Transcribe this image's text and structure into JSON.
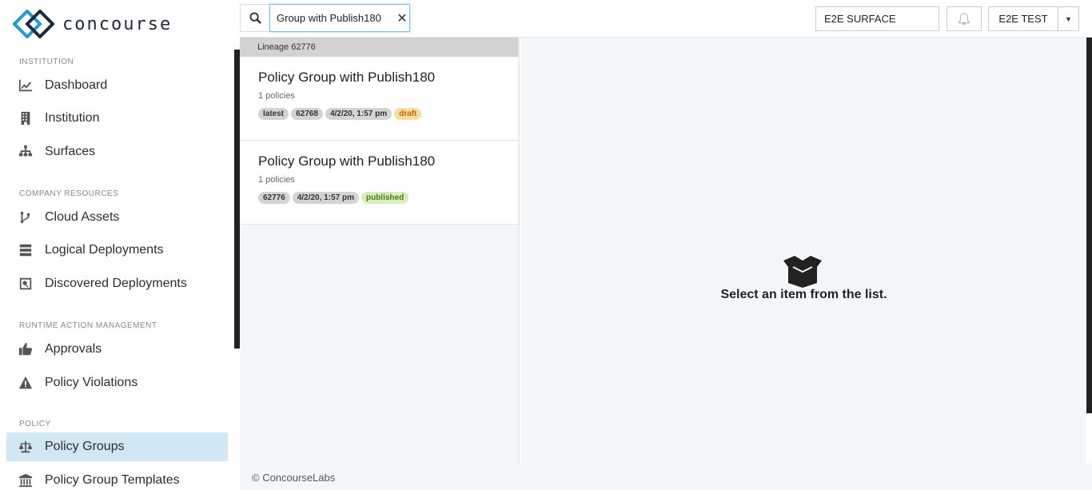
{
  "app": {
    "logo_text": "concourse"
  },
  "sidebar": {
    "sections": [
      {
        "title": "INSTITUTION"
      },
      {
        "title": "COMPANY RESOURCES"
      },
      {
        "title": "RUNTIME ACTION MANAGEMENT"
      },
      {
        "title": "POLICY"
      }
    ],
    "items": [
      {
        "label": "Dashboard",
        "icon": "chart-icon"
      },
      {
        "label": "Institution",
        "icon": "building-icon"
      },
      {
        "label": "Surfaces",
        "icon": "sitemap-icon"
      },
      {
        "label": "Cloud Assets",
        "icon": "branch-icon"
      },
      {
        "label": "Logical Deployments",
        "icon": "server-icon"
      },
      {
        "label": "Discovered Deployments",
        "icon": "search-server-icon"
      },
      {
        "label": "Approvals",
        "icon": "thumbs-up-icon"
      },
      {
        "label": "Policy Violations",
        "icon": "warning-icon"
      },
      {
        "label": "Policy Groups",
        "icon": "balance-scale-icon",
        "active": true
      },
      {
        "label": "Policy Group Templates",
        "icon": "institution-icon"
      }
    ]
  },
  "topbar": {
    "search_value": "Group with Publish180",
    "surface": "E2E SURFACE",
    "user": "E2E TEST"
  },
  "list": {
    "lineage_header": "Lineage 62776",
    "items": [
      {
        "title": "Policy Group with Publish180",
        "sub": "1 policies",
        "badges": [
          "latest",
          "62768",
          "4/2/20, 1:57 pm",
          "draft"
        ]
      },
      {
        "title": "Policy Group with Publish180",
        "sub": "1 policies",
        "badges": [
          "62776",
          "4/2/20, 1:57 pm",
          "published"
        ]
      }
    ]
  },
  "detail": {
    "empty_message": "Select an item from the list."
  },
  "footer": {
    "text": "© ConcourseLabs"
  },
  "colors": {
    "active_nav": "#cfe8f3",
    "draft": "#fcdba0",
    "published": "#d8f0b8",
    "brand": "#1f9bd3"
  }
}
